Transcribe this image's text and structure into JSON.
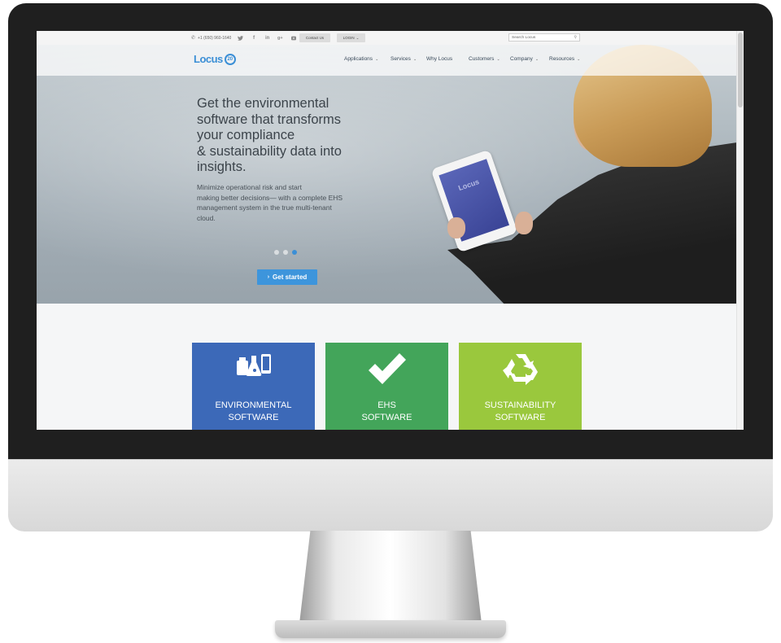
{
  "topbar": {
    "phone": "+1 (650) 960-1640",
    "social_icons": [
      "twitter-icon",
      "facebook-icon",
      "linkedin-icon",
      "google-plus-icon",
      "youtube-icon"
    ],
    "contact_label": "Contact Us",
    "login_label": "LOGIN",
    "search_placeholder": "Search Locus"
  },
  "nav": {
    "logo_text": "Locus",
    "logo_badge": "20",
    "items": [
      {
        "label": "Applications",
        "has_dropdown": true
      },
      {
        "label": "Services",
        "has_dropdown": true
      },
      {
        "label": "Why Locus",
        "has_dropdown": false
      },
      {
        "label": "Customers",
        "has_dropdown": true
      },
      {
        "label": "Company",
        "has_dropdown": true
      },
      {
        "label": "Resources",
        "has_dropdown": true
      }
    ]
  },
  "hero": {
    "title": "Get the environmental\nsoftware that transforms\nyour compliance\n& sustainability data into\ninsights.",
    "subtitle": "Minimize operational risk and start\nmaking better decisions— with a complete EHS\nmanagement system in the true multi-tenant\ncloud.",
    "tablet_logo": "Locus",
    "slides": 3,
    "active_slide": 3,
    "cta_label": "Get started"
  },
  "cards": [
    {
      "label": "ENVIRONMENTAL\nSOFTWARE",
      "icon": "lab-devices-icon",
      "color": "#3c69b8"
    },
    {
      "label": "EHS\nSOFTWARE",
      "icon": "checkmark-icon",
      "color": "#43a55a"
    },
    {
      "label": "SUSTAINABILITY\nSOFTWARE",
      "icon": "recycle-icon",
      "color": "#9ac83d"
    }
  ],
  "colors": {
    "accent": "#3d95dc",
    "monitor_bezel": "#1f1f1f"
  }
}
